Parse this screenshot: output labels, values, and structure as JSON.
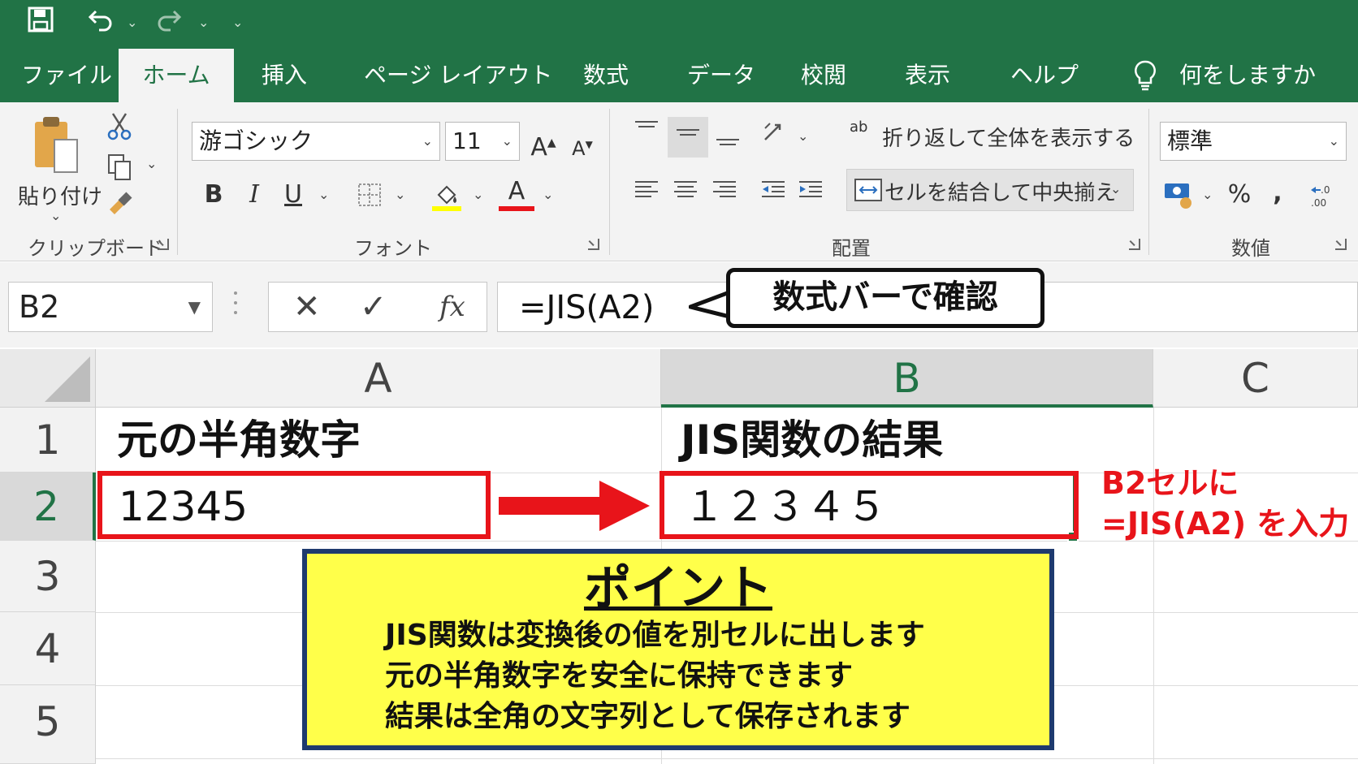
{
  "qat": {
    "save_icon": "save-icon",
    "undo_icon": "undo-icon",
    "redo_icon": "redo-icon",
    "caret": "⌄",
    "customize": "⌄"
  },
  "tabs": [
    {
      "label": "ファイル"
    },
    {
      "label": "ホーム",
      "active": true
    },
    {
      "label": "挿入"
    },
    {
      "label": "ページ レイアウト"
    },
    {
      "label": "数式"
    },
    {
      "label": "データ"
    },
    {
      "label": "校閲"
    },
    {
      "label": "表示"
    },
    {
      "label": "ヘルプ"
    }
  ],
  "tell_me": {
    "label": "何をしますか",
    "icon": "lightbulb-icon"
  },
  "ribbon": {
    "clipboard": {
      "paste_label": "貼り付け",
      "group_label": "クリップボード"
    },
    "font": {
      "name": "游ゴシック",
      "size": "11",
      "grow": "A",
      "shrink": "A",
      "bold": "B",
      "italic": "I",
      "underline": "U",
      "font_color_glyph": "A",
      "group_label": "フォント",
      "highlight_color": "#ffff00",
      "font_color": "#ff0000"
    },
    "alignment": {
      "wrap_label": "折り返して全体を表示する",
      "wrap_icon_text": "ab",
      "merge_label": "セルを結合して中央揃え",
      "group_label": "配置"
    },
    "number": {
      "format": "標準",
      "percent": "%",
      "comma": ",",
      "group_label": "数値"
    }
  },
  "formula_bar": {
    "name_box": "B2",
    "cancel": "✕",
    "enter": "✓",
    "fx": "fx",
    "formula": "=JIS(A2)"
  },
  "callout": {
    "text": "数式バーで確認"
  },
  "columns": [
    "A",
    "B",
    "C"
  ],
  "selected_column": "B",
  "rows": [
    "1",
    "2",
    "3",
    "4",
    "5"
  ],
  "selected_row": "2",
  "cells": {
    "A1": "元の半角数字",
    "B1": "JIS関数の結果",
    "A2": "12345",
    "B2": "１２３４５"
  },
  "note": {
    "line1": "B2セルに",
    "line2": "=JIS(A2) を入力"
  },
  "point": {
    "title": "ポイント",
    "lines": [
      "JIS関数は変換後の値を別セルに出します",
      "元の半角数字を安全に保持できます",
      "結果は全角の文字列として保存されます"
    ]
  },
  "colors": {
    "excel_green": "#217346",
    "annotation_red": "#e8141a",
    "point_bg": "#ffff4a",
    "point_border": "#1e3a6e"
  }
}
